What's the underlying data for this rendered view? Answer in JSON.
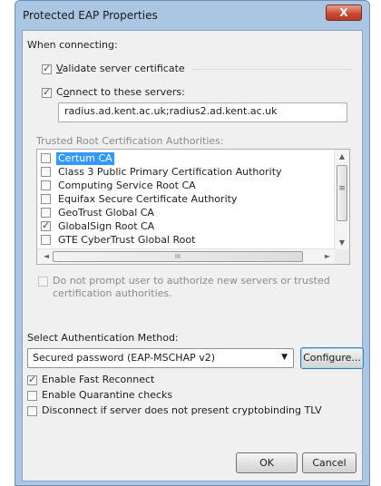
{
  "window": {
    "title": "Protected EAP Properties",
    "close_glyph": "X"
  },
  "connecting": {
    "heading": "When connecting:",
    "validate_label": "Validate server certificate",
    "validate_accel": "V",
    "validate_rest": "alidate server certificate",
    "connect_accel": "o",
    "connect_pre": "C",
    "connect_rest": "nnect to these servers:",
    "servers_value": "radius.ad.kent.ac.uk;radius2.ad.kent.ac.uk"
  },
  "trusted": {
    "heading": "Trusted Root Certification Authorities:",
    "items": [
      {
        "label": "Certum CA",
        "checked": false,
        "selected": true
      },
      {
        "label": "Class 3 Public Primary Certification Authority",
        "checked": false,
        "selected": false
      },
      {
        "label": "Computing Service Root CA",
        "checked": false,
        "selected": false
      },
      {
        "label": "Equifax Secure Certificate Authority",
        "checked": false,
        "selected": false
      },
      {
        "label": "GeoTrust Global CA",
        "checked": false,
        "selected": false
      },
      {
        "label": "GlobalSign Root CA",
        "checked": true,
        "selected": false
      },
      {
        "label": "GTE CyberTrust Global Root",
        "checked": false,
        "selected": false
      }
    ],
    "hscroll_thumb_glyph": "III"
  },
  "prompt": {
    "line1": "Do not prompt user to authorize new servers or trusted",
    "line2": "certification authorities."
  },
  "auth": {
    "heading": "Select Authentication Method:",
    "selected_method": "Secured password (EAP-MSCHAP v2)",
    "configure_label": "Configure..."
  },
  "options": {
    "fast_reconnect": "Enable Fast Reconnect",
    "quarantine": "Enable Quarantine checks",
    "cryptobinding": "Disconnect if server does not present cryptobinding TLV"
  },
  "buttons": {
    "ok": "OK",
    "cancel": "Cancel"
  },
  "colors": {
    "frame": "#aac6e3",
    "selection": "#3399ff",
    "close": "#c8472f"
  }
}
